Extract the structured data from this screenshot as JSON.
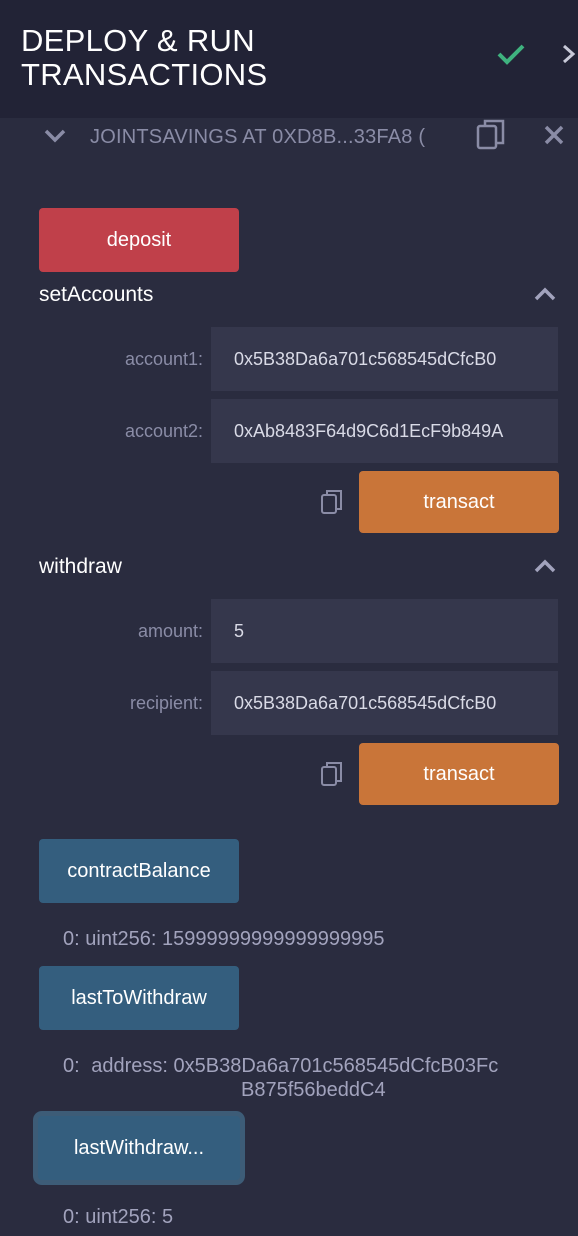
{
  "header": {
    "title": "DEPLOY & RUN TRANSACTIONS"
  },
  "instance": {
    "title": "JOINTSAVINGS AT 0XD8B...33FA8 ("
  },
  "deposit": {
    "label": "deposit"
  },
  "setAccounts": {
    "title": "setAccounts",
    "fields": [
      {
        "label": "account1:",
        "value": "0x5B38Da6a701c568545dCfcB0"
      },
      {
        "label": "account2:",
        "value": "0xAb8483F64d9C6d1EcF9b849A"
      }
    ],
    "transact_label": "transact"
  },
  "withdraw": {
    "title": "withdraw",
    "fields": [
      {
        "label": "amount:",
        "value": "5"
      },
      {
        "label": "recipient:",
        "value": "0x5B38Da6a701c568545dCfcB0"
      }
    ],
    "transact_label": "transact"
  },
  "calls": [
    {
      "label": "contractBalance",
      "index": "0:",
      "output": "uint256: 15999999999999999995"
    },
    {
      "label": "lastToWithdraw",
      "index": "0:",
      "output_line1": "address: 0x5B38Da6a701c568545dCfcB03Fc",
      "output_line2": "B875f56beddC4"
    },
    {
      "label": "lastWithdraw...",
      "index": "0:",
      "output": "uint256: 5"
    }
  ],
  "colors": {
    "accent_red": "#c0404a",
    "accent_orange": "#c97539",
    "accent_blue": "#345e7e",
    "success": "#3fb27f"
  }
}
